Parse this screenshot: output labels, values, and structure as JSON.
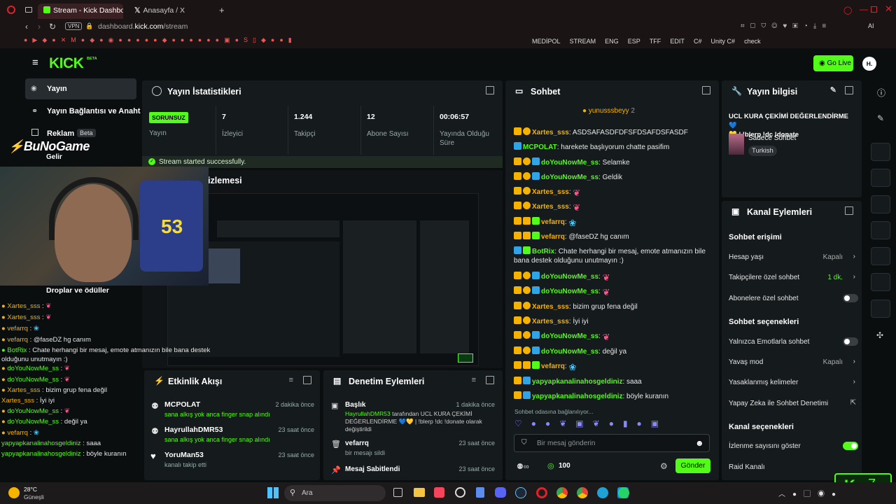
{
  "browser": {
    "tabs": [
      {
        "label": "Stream - Kick Dashboard"
      },
      {
        "label": "Anasayfa / X"
      }
    ],
    "url_host": "dashboard.",
    "url_domain": "kick.com",
    "url_path": "/stream",
    "vpn": "VPN",
    "ai": "AI"
  },
  "bookmarks": [
    "MEDİPOL",
    "STREAM",
    "ENG",
    "ESP",
    "TFF",
    "EDIT",
    "C#",
    "Unity C#",
    "check"
  ],
  "nav": {
    "logo": "KICK",
    "beta": "BETA",
    "go_live": "Go Live",
    "avatar": "H."
  },
  "sidebar": {
    "items": [
      {
        "label": "Yayın"
      },
      {
        "label": "Yayın Bağlantısı ve Anahtarı"
      },
      {
        "label": "Reklam",
        "badge": "Beta"
      },
      {
        "label": "Gelir"
      },
      {
        "label": "Droplar ve ödüller"
      }
    ]
  },
  "stats": {
    "title": "Yayın İstatistikleri",
    "status": "SORUNSUZ",
    "status_label": "Yayın",
    "items": [
      {
        "value": "7",
        "label": "İzleyici"
      },
      {
        "value": "1.244",
        "label": "Takipçi"
      },
      {
        "value": "12",
        "label": "Abone Sayısı"
      },
      {
        "value": "00:06:57",
        "label": "Yayında Olduğu Süre"
      }
    ],
    "success": "Stream started successfully."
  },
  "preview": {
    "title_fragment": "izlemesi"
  },
  "overlay": {
    "brand": "BuNoGame",
    "chat": [
      {
        "u": "Xartes_sss",
        "t": ""
      },
      {
        "u": "Xartes_sss",
        "t": ""
      },
      {
        "u": "vefarrq",
        "t": ""
      },
      {
        "u": "vefarrq",
        "t": "@faseDZ hg canım"
      },
      {
        "u": "BotRix",
        "t": "Chate herhangi bir mesaj, emote atmanızın bile bana destek olduğunu unutmayın :)"
      },
      {
        "u": "doYouNowMe_ss",
        "t": ""
      },
      {
        "u": "doYouNowMe_ss",
        "t": ""
      },
      {
        "u": "Xartes_sss",
        "t": "bizim grup fena değil"
      },
      {
        "u": "Xartes_sss",
        "t": "İyi iyi"
      },
      {
        "u": "doYouNowMe_ss",
        "t": ""
      },
      {
        "u": "doYouNowMe_ss",
        "t": "değil ya"
      },
      {
        "u": "vefarrq",
        "t": ""
      },
      {
        "u": "yapyapkanalinahosgeldiniz",
        "t": "saaa"
      },
      {
        "u": "yapyapkanalinahosgeldiniz",
        "t": "böyle kuranın"
      }
    ]
  },
  "activity": {
    "title": "Etkinlik Akışı",
    "items": [
      {
        "user": "MCPOLAT",
        "time": "2 dakika önce",
        "desc": "sana alkış yok anca finger snap alındı"
      },
      {
        "user": "HayrullahDMR53",
        "time": "23 saat önce",
        "desc": "sana alkış yok anca finger snap alındı"
      },
      {
        "user": "YoruMan53",
        "time": "23 saat önce",
        "desc": "kanalı takip etti"
      }
    ]
  },
  "moderation": {
    "title": "Denetim Eylemleri",
    "items": [
      {
        "title": "Başlık",
        "time": "1 dakika önce",
        "actor": "HayrullahDMR53",
        "line1": "tarafından UCL KURA ÇEKİMİ",
        "line2": "DEĞERLENDİRME 💙💛 | !blerp !dc !donate olarak",
        "line3": "değiştirildi"
      },
      {
        "title": "vefarrq",
        "time": "23 saat önce",
        "desc": "bir mesajı sildi"
      },
      {
        "title": "Mesaj Sabitlendi",
        "time": "23 saat önce",
        "desc": ""
      }
    ]
  },
  "chat": {
    "title": "Sohbet",
    "pinned_user": "yunusssbeyy",
    "pinned_count": "2",
    "messages": [
      {
        "u": "Xartes_sss",
        "t": ": ASDSAFASDFDFSFDSAFDSFASDF",
        "c": "#f5b300"
      },
      {
        "u": "MCPOLAT",
        "t": ": harekete başlıyorum chatte pasifim",
        "c": "#53fc18"
      },
      {
        "u": "doYouNowMe_ss",
        "t": ": Selamke",
        "c": "#53fc18"
      },
      {
        "u": "doYouNowMe_ss",
        "t": ": Geldik",
        "c": "#53fc18"
      },
      {
        "u": "Xartes_sss",
        "t": ":",
        "c": "#f5b300"
      },
      {
        "u": "Xartes_sss",
        "t": ":",
        "c": "#f5b300"
      },
      {
        "u": "vefarrq",
        "t": ":",
        "c": "#f5b300"
      },
      {
        "u": "vefarrq",
        "t": ": @faseDZ hg canım",
        "c": "#f5b300"
      },
      {
        "u": "BotRix",
        "t": ": Chate herhangi bir mesaj, emote atmanızın bile",
        "c": "#53fc18"
      },
      {
        "u": "",
        "t": "bana destek olduğunu unutmayın :)",
        "c": "#fff"
      },
      {
        "u": "doYouNowMe_ss",
        "t": ":",
        "c": "#53fc18"
      },
      {
        "u": "doYouNowMe_ss",
        "t": ":",
        "c": "#53fc18"
      },
      {
        "u": "Xartes_sss",
        "t": ": bizim grup fena değil",
        "c": "#f5b300"
      },
      {
        "u": "Xartes_sss",
        "t": ": İyi iyi",
        "c": "#f5b300"
      },
      {
        "u": "doYouNowMe_ss",
        "t": ":",
        "c": "#53fc18"
      },
      {
        "u": "doYouNowMe_ss",
        "t": ": değil ya",
        "c": "#53fc18"
      },
      {
        "u": "vefarrq",
        "t": ":",
        "c": "#f5b300"
      },
      {
        "u": "yapyapkanalinahosgeldiniz",
        "t": ": saaa",
        "c": "#53fc18"
      },
      {
        "u": "yapyapkanalinahosgeldiniz",
        "t": ": böyle kuranın",
        "c": "#53fc18"
      }
    ],
    "connecting": "Sohbet odasına bağlanılıyor...",
    "placeholder": "Bir mesaj gönderin",
    "points": "100",
    "send": "Gönder"
  },
  "info": {
    "title": "Yayın bilgisi",
    "stream_title": "UCL KURA ÇEKİMİ DEĞERLENDİRME 💙",
    "stream_title2": "💛 | !blerp !dc !donate",
    "category": "Sadece Sohbet",
    "language": "Turkish"
  },
  "channel": {
    "title": "Kanal Eylemleri",
    "chat_access": "Sohbet erişimi",
    "rows": [
      {
        "label": "Hesap yaşı",
        "value": "Kapalı"
      },
      {
        "label": "Takipçilere özel sohbet",
        "value": "1 dk."
      },
      {
        "label": "Abonelere özel sohbet",
        "value": ""
      }
    ],
    "chat_options": "Sohbet seçenekleri",
    "rows2": [
      {
        "label": "Yalnızca Emotlarla sohbet",
        "value": ""
      },
      {
        "label": "Yavaş mod",
        "value": "Kapalı"
      },
      {
        "label": "Yasaklanmış kelimeler",
        "value": ""
      },
      {
        "label": "Yapay Zeka ile Sohbet Denetimi",
        "value": ""
      }
    ],
    "channel_options": "Kanal seçenekleri",
    "rows3": [
      {
        "label": "İzlenme sayısını göster"
      },
      {
        "label": "Raid Kanalı"
      }
    ]
  },
  "widget": {
    "count": "7"
  },
  "taskbar": {
    "temp": "28°C",
    "weather": "Güneşli",
    "search": "Ara"
  },
  "colors": {
    "accent": "#53fc18",
    "panel": "#151a1c",
    "bg": "#0b0e0f"
  }
}
